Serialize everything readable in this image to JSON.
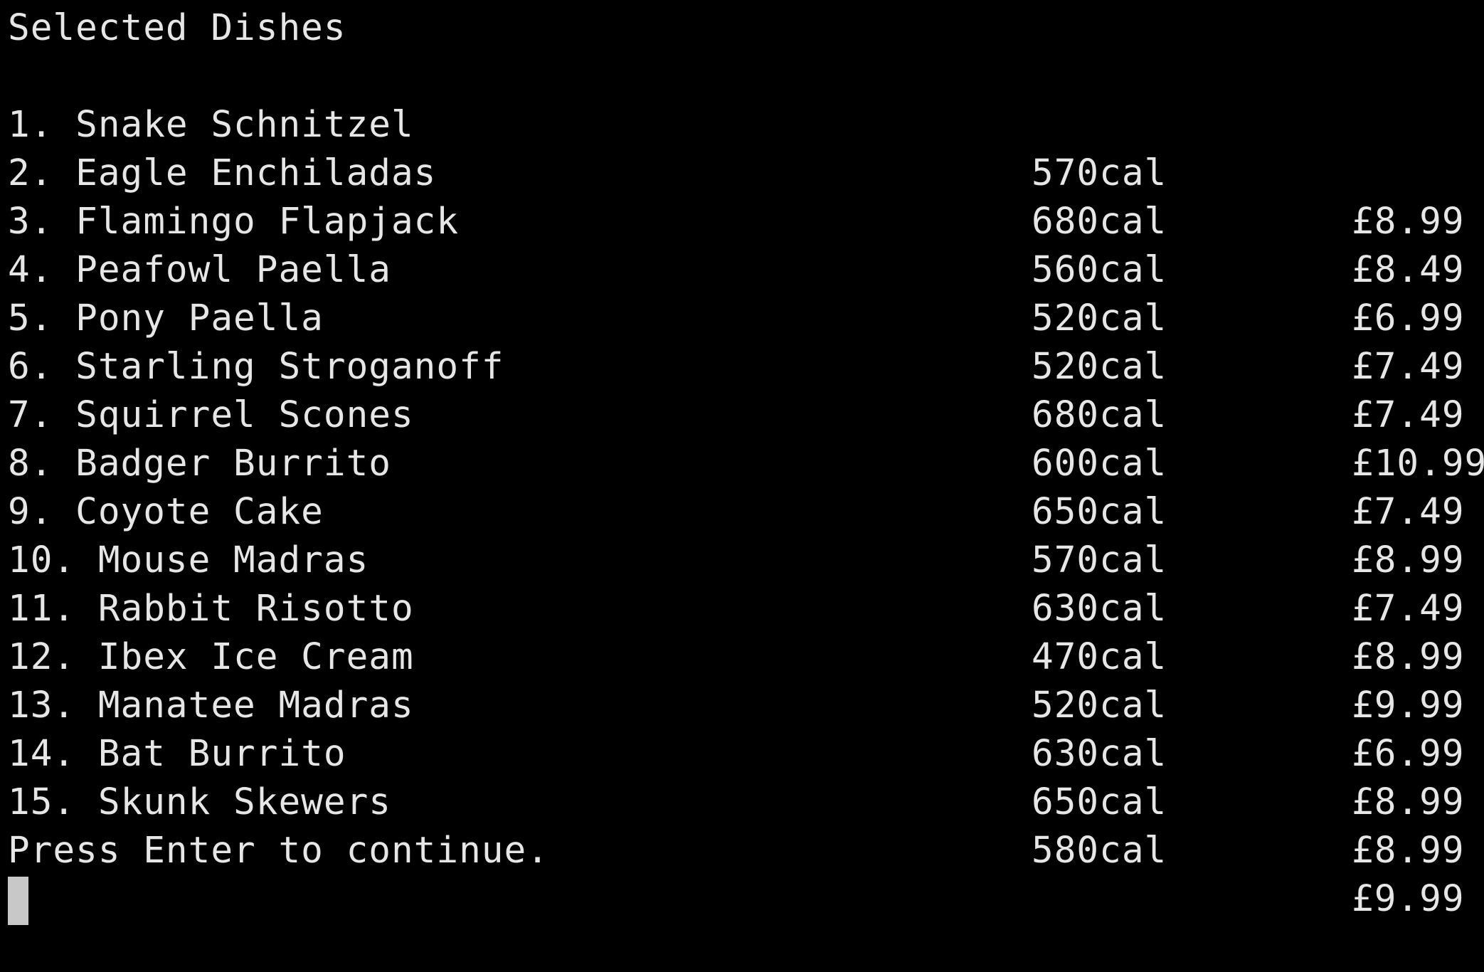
{
  "terminal": {
    "heading": "Selected Dishes",
    "dishes": [
      {
        "name": "1. Snake Schnitzel",
        "calories": "570cal",
        "price": "£8.99"
      },
      {
        "name": "2. Eagle Enchiladas",
        "calories": "680cal",
        "price": "£8.49"
      },
      {
        "name": "3. Flamingo Flapjack",
        "calories": "560cal",
        "price": "£6.99"
      },
      {
        "name": "4. Peafowl Paella",
        "calories": "520cal",
        "price": "£7.49"
      },
      {
        "name": "5. Pony Paella",
        "calories": "520cal",
        "price": "£7.49"
      },
      {
        "name": "6. Starling Stroganoff",
        "calories": "680cal",
        "price": "£10.99"
      },
      {
        "name": "7. Squirrel Scones",
        "calories": "600cal",
        "price": "£7.49"
      },
      {
        "name": "8. Badger Burrito",
        "calories": "650cal",
        "price": "£8.99"
      },
      {
        "name": "9. Coyote Cake",
        "calories": "570cal",
        "price": "£7.49"
      },
      {
        "name": "10. Mouse Madras",
        "calories": "630cal",
        "price": "£8.99"
      },
      {
        "name": "11. Rabbit Risotto",
        "calories": "470cal",
        "price": "£9.99"
      },
      {
        "name": "12. Ibex Ice Cream",
        "calories": "520cal",
        "price": "£6.99"
      },
      {
        "name": "13. Manatee Madras",
        "calories": "630cal",
        "price": "£8.99"
      },
      {
        "name": "14. Bat Burrito",
        "calories": "650cal",
        "price": "£8.99"
      },
      {
        "name": "15. Skunk Skewers",
        "calories": "580cal",
        "price": "£9.99"
      }
    ],
    "prompt": "Press Enter to continue.",
    "colors": {
      "background": "#000000",
      "foreground": "#e6e6e6",
      "cursor": "#c8c8c8"
    }
  }
}
